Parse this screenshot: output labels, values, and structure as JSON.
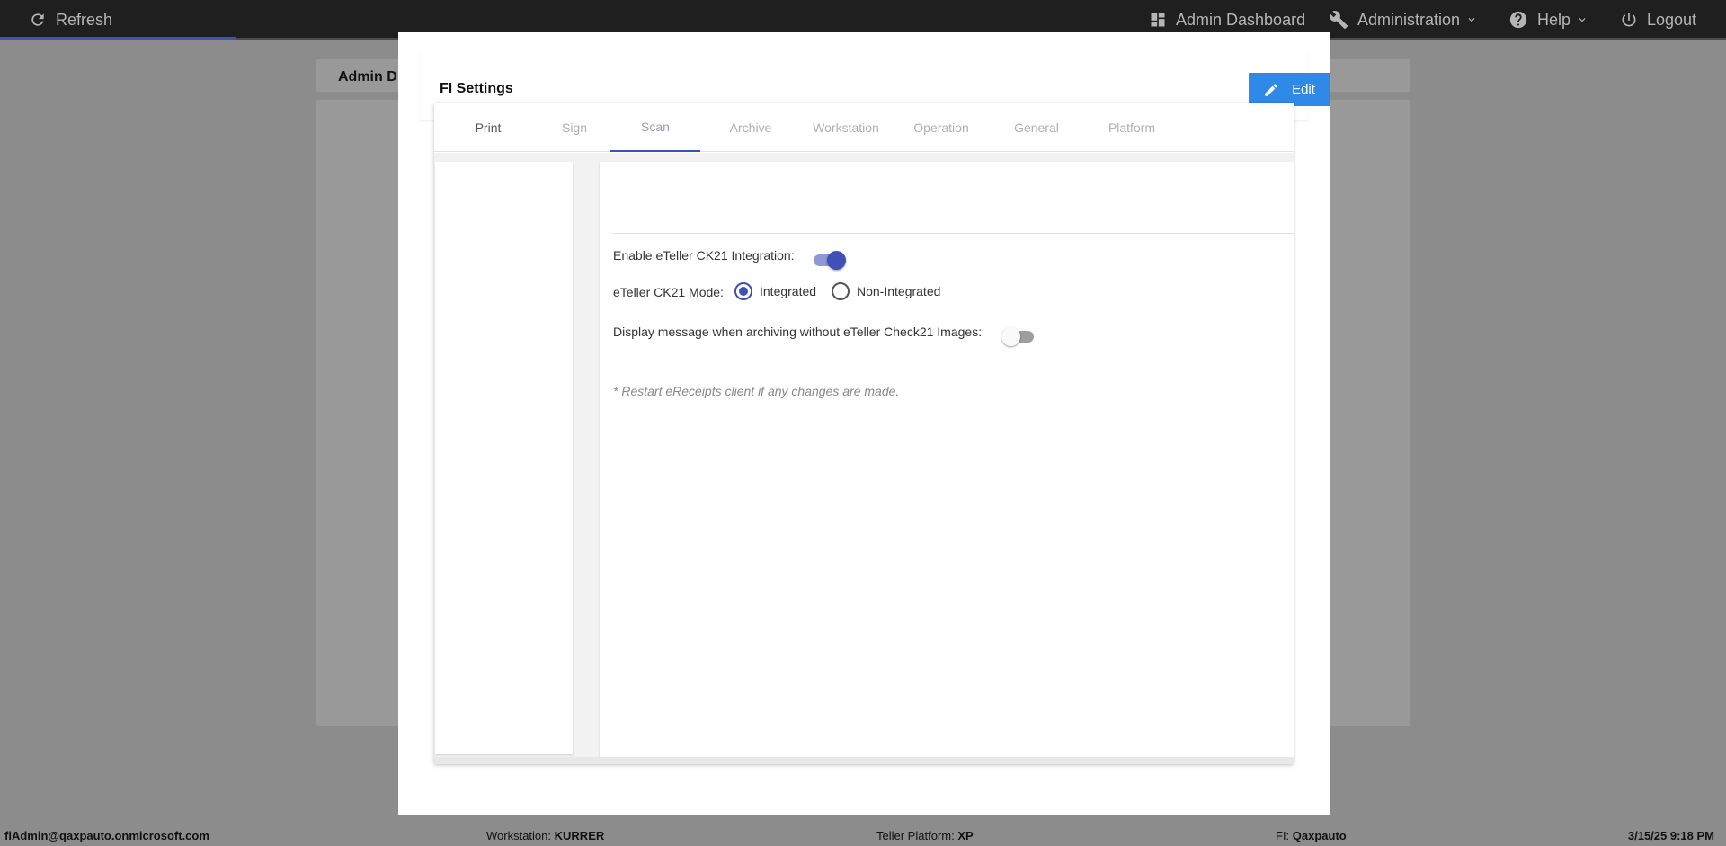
{
  "topbar": {
    "refresh_label": "Refresh",
    "admin_dashboard_label": "Admin Dashboard",
    "administration_label": "Administration",
    "help_label": "Help",
    "logout_label": "Logout"
  },
  "background": {
    "card_title": "Admin D"
  },
  "modal": {
    "title": "FI Settings",
    "edit_label": "Edit",
    "tabs": [
      {
        "label": "Print"
      },
      {
        "label": "Sign"
      },
      {
        "label": "Scan",
        "active": true
      },
      {
        "label": "Archive"
      },
      {
        "label": "Workstation"
      },
      {
        "label": "Operation"
      },
      {
        "label": "General"
      },
      {
        "label": "Platform"
      }
    ],
    "scan": {
      "ck21_integration_label": "Enable eTeller CK21 Integration:",
      "ck21_integration_enabled": true,
      "ck21_mode_label": "eTeller CK21 Mode:",
      "ck21_mode_options": [
        "Integrated",
        "Non-Integrated"
      ],
      "ck21_mode_selected": "Integrated",
      "archive_message_label": "Display message when archiving without eTeller Check21 Images:",
      "archive_message_enabled": false,
      "restart_note": "* Restart eReceipts client if any changes are made."
    }
  },
  "statusbar": {
    "user": "fiAdmin@qaxpauto.onmicrosoft.com",
    "workstation_label": "Workstation:",
    "workstation_value": "KURRER",
    "teller_platform_label": "Teller Platform:",
    "teller_platform_value": "XP",
    "fi_label": "FI:",
    "fi_value": "Qaxpauto",
    "datetime": "3/15/25 9:18 PM"
  },
  "colors": {
    "accent": "#3f51b5",
    "edit_button": "#2e8ae6",
    "topbar": "#1f1f1f"
  }
}
